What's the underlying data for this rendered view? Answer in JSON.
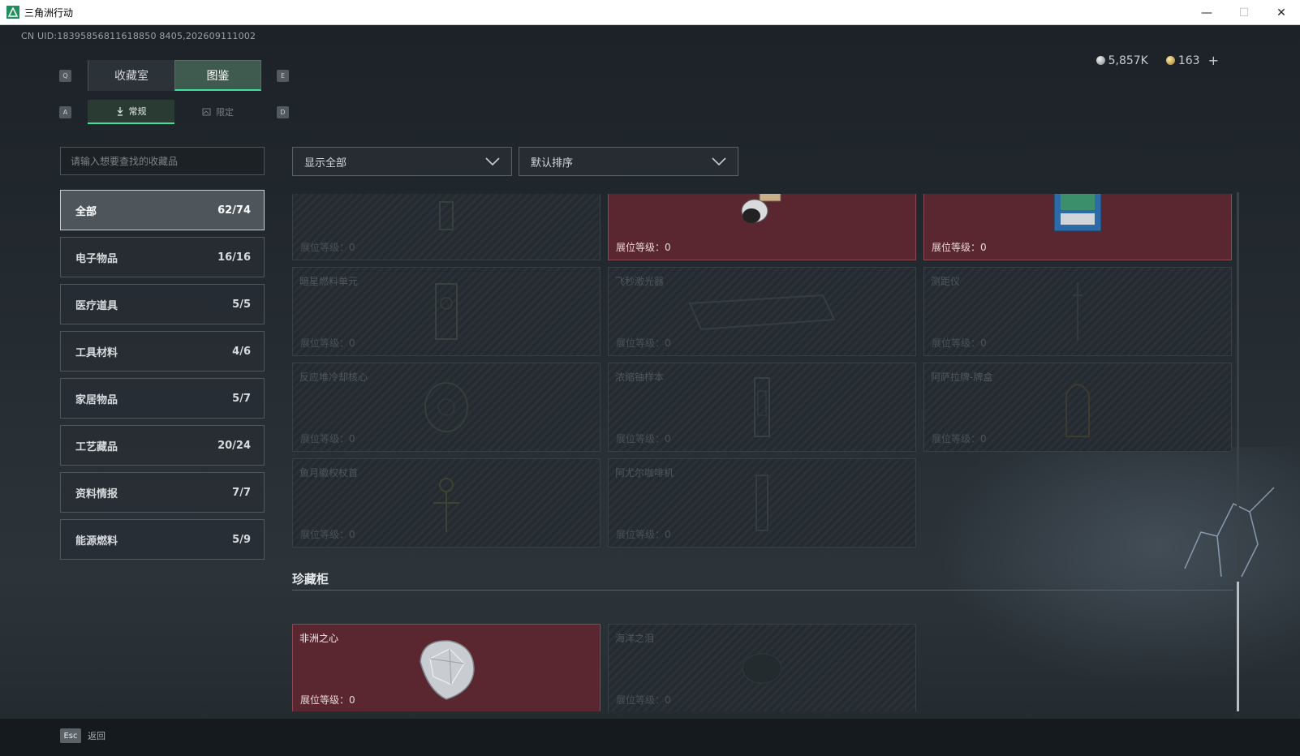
{
  "window": {
    "title": "三角洲行动",
    "minimize": "—",
    "maximize": "☐",
    "close": "✕"
  },
  "uid": "CN UID:18395856811618850 8405,202609111002",
  "currency": {
    "silver": "5,857K",
    "gold": "163",
    "add": "+"
  },
  "keys": {
    "q": "Q",
    "e": "E",
    "a": "A",
    "d": "D"
  },
  "tabs_main": [
    {
      "label": "收藏室"
    },
    {
      "label": "图鉴"
    }
  ],
  "tabs_sub": [
    {
      "label": "常规"
    },
    {
      "label": "限定"
    }
  ],
  "search": {
    "placeholder": "请输入想要查找的收藏品"
  },
  "categories": [
    {
      "label": "全部",
      "count": "62/74"
    },
    {
      "label": "电子物品",
      "count": "16/16"
    },
    {
      "label": "医疗道具",
      "count": "5/5"
    },
    {
      "label": "工具材料",
      "count": "4/6"
    },
    {
      "label": "家居物品",
      "count": "5/7"
    },
    {
      "label": "工艺藏品",
      "count": "20/24"
    },
    {
      "label": "资料情报",
      "count": "7/7"
    },
    {
      "label": "能源燃料",
      "count": "5/9"
    }
  ],
  "filter": {
    "show": "显示全部",
    "sort": "默认排序"
  },
  "items": [
    {
      "name": "",
      "level": "展位等级：0",
      "owned": false,
      "icon": "fuel-icon"
    },
    {
      "name": "",
      "level": "展位等级：0",
      "owned": true,
      "icon": "lens-device-icon"
    },
    {
      "name": "",
      "level": "展位等级：0",
      "owned": true,
      "icon": "circuit-box-icon"
    },
    {
      "name": "暗星燃料单元",
      "level": "展位等级：0",
      "owned": false,
      "icon": "fuel-cell-icon"
    },
    {
      "name": "飞秒激光器",
      "level": "展位等级：0",
      "owned": false,
      "icon": "laser-icon"
    },
    {
      "name": "测距仪",
      "level": "展位等级：0",
      "owned": false,
      "icon": "rangefinder-icon"
    },
    {
      "name": "反应堆冷却核心",
      "level": "展位等级：0",
      "owned": false,
      "icon": "reactor-core-icon"
    },
    {
      "name": "浓缩铀样本",
      "level": "展位等级：0",
      "owned": false,
      "icon": "uranium-icon"
    },
    {
      "name": "阿萨拉牌-牌盒",
      "level": "展位等级：0",
      "owned": false,
      "icon": "card-box-icon"
    },
    {
      "name": "鱼月徽权杖首",
      "level": "展位等级：0",
      "owned": false,
      "icon": "scepter-icon"
    },
    {
      "name": "阿尤尔咖啡机",
      "level": "展位等级：0",
      "owned": false,
      "icon": "coffee-machine-icon"
    }
  ],
  "treasure": {
    "title": "珍藏柜",
    "items": [
      {
        "name": "非洲之心",
        "level": "展位等级：0",
        "owned": true,
        "icon": "diamond-icon"
      },
      {
        "name": "海洋之泪",
        "level": "展位等级：0",
        "owned": false,
        "icon": "gem-icon"
      }
    ]
  },
  "footer": {
    "key": "Esc",
    "label": "返回"
  },
  "colors": {
    "accent": "#3ee09d",
    "owned": "#5a2730"
  }
}
